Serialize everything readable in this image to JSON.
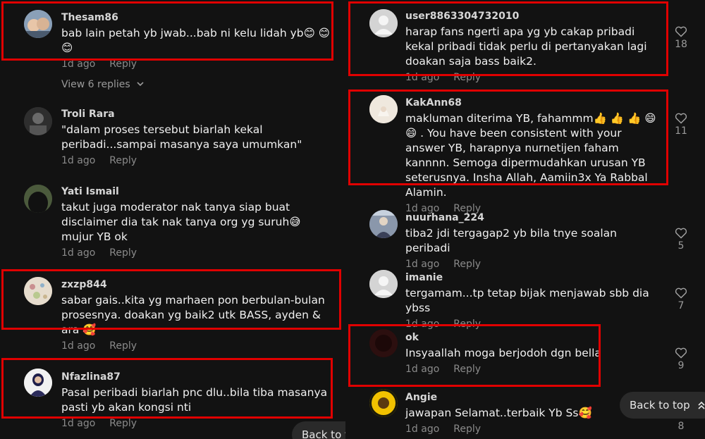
{
  "left_comments": [
    {
      "username": "Thesam86",
      "text": "bab lain petah yb jwab...bab ni kelu lidah yb😊 😊 😊",
      "time": "1d ago",
      "reply": "Reply",
      "avatar_color": "#6b7f93"
    },
    {
      "username": "Troli Rara",
      "text": "\"dalam proses tersebut biarlah kekal peribadi...sampai masanya saya umumkan\"",
      "time": "1d ago",
      "reply": "Reply",
      "avatar_color": "#3c3c3c"
    },
    {
      "username": "Yati Ismail",
      "text": "takut juga moderator nak tanya siap buat disclaimer dia tak nak tanya org yg suruh😅 mujur YB ok",
      "time": "1d ago",
      "reply": "Reply",
      "avatar_color": "#36422e"
    },
    {
      "username": "zxzp844",
      "text": "sabar gais..kita yg marhaen pon berbulan-bulan prosesnya. doakan yg baik2 utk BASS, ayden & ara 🥰",
      "time": "1d ago",
      "reply": "Reply",
      "avatar_color": "#d9c9b8"
    },
    {
      "username": "Nfazlina87",
      "text": "Pasal peribadi biarlah pnc dlu..bila tiba masanya pasti yb akan kongsi nti",
      "time": "1d ago",
      "reply": "Reply",
      "avatar_color": "#f0f0f0"
    }
  ],
  "view_replies": "View 6 replies",
  "right_comments": [
    {
      "username": "user8863304732010",
      "text": "harap fans ngerti apa yg yb cakap pribadi kekal pribadi tidak perlu di pertanyakan lagi doakan saja bass baik2.",
      "time": "1d ago",
      "reply": "Reply",
      "likes": "18",
      "avatar_color": "#d0d0d0"
    },
    {
      "username": "KakAnn68",
      "text": "makluman diterima YB, fahammm👍 👍 👍 😄 😄 . You have been consistent with your answer YB, harapnya nurnetijen faham kannnn. Semoga dipermudahkan urusan YB seterusnya. Insha Allah, Aamiin3x Ya Rabbal Alamin.",
      "time": "1d ago",
      "reply": "Reply",
      "likes": "11",
      "avatar_color": "#e9e2d6"
    },
    {
      "username": "nuurhana_224",
      "text": "tiba2 jdi tergagap2 yb bila tnye soalan peribadi",
      "time": "1d ago",
      "reply": "Reply",
      "likes": "5",
      "avatar_color": "#7e8aa0"
    },
    {
      "username": "imanie",
      "text": "tergamam...tp tetap bijak menjawab sbb dia ybss",
      "time": "1d ago",
      "reply": "Reply",
      "likes": "7",
      "avatar_color": "#d0d0d0"
    },
    {
      "username": "ok",
      "text": "Insyaallah moga berjodoh dgn bella",
      "time": "1d ago",
      "reply": "Reply",
      "likes": "9",
      "avatar_color": "#2a0d0d"
    },
    {
      "username": "Angie",
      "text": "jawapan Selamat..terbaik Yb Ss🥰",
      "time": "1d ago",
      "reply": "Reply",
      "likes": "8",
      "avatar_color": "#e8b400"
    }
  ],
  "back_to_top": "Back to top",
  "back_to_top_partial": "Back to to",
  "highlight_color": "#e00000"
}
